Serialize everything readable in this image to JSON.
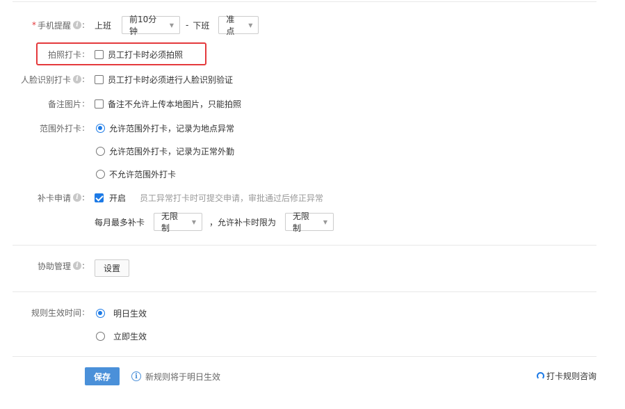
{
  "phone_reminder": {
    "label": "手机提醒",
    "on_label": "上班",
    "on_select": "前10分钟",
    "separator": "-",
    "off_label": "下班",
    "off_select": "准点"
  },
  "photo_clock": {
    "label": "拍照打卡",
    "option": "员工打卡时必须拍照"
  },
  "face_clock": {
    "label": "人脸识别打卡",
    "option": "员工打卡时必须进行人脸识别验证"
  },
  "note_image": {
    "label": "备注图片",
    "option": "备注不允许上传本地图片，只能拍照"
  },
  "out_of_range": {
    "label": "范围外打卡",
    "options": [
      "允许范围外打卡，记录为地点异常",
      "允许范围外打卡，记录为正常外勤",
      "不允许范围外打卡"
    ],
    "selected_index": 0
  },
  "make_up": {
    "label": "补卡申请",
    "enable_label": "开启",
    "hint": "员工异常打卡时可提交申请，审批通过后修正异常",
    "monthly_label": "每月最多补卡",
    "monthly_select": "无限制",
    "limit_label": "，允许补卡时限为",
    "limit_select": "无限制"
  },
  "assist": {
    "label": "协助管理",
    "button": "设置"
  },
  "effective": {
    "label": "规则生效时间",
    "options": [
      "明日生效",
      "立即生效"
    ],
    "selected_index": 0
  },
  "footer": {
    "save": "保存",
    "tip": "新规则将于明日生效",
    "consult": "打卡规则咨询"
  },
  "colors": {
    "accent": "#1c7ae6",
    "primary_button": "#4a90d9",
    "required": "#e4393c",
    "highlight_border": "#e4393c"
  }
}
